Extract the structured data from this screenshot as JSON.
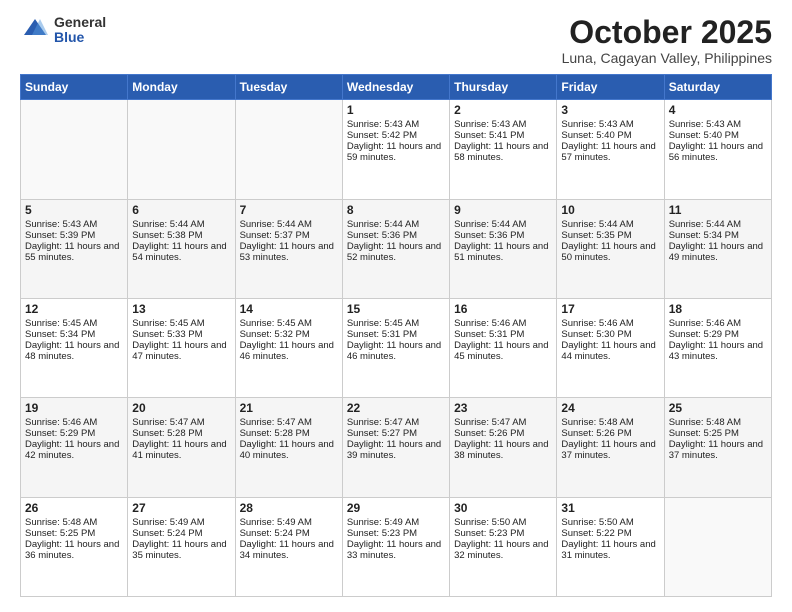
{
  "header": {
    "logo_general": "General",
    "logo_blue": "Blue",
    "month_title": "October 2025",
    "subtitle": "Luna, Cagayan Valley, Philippines"
  },
  "days_of_week": [
    "Sunday",
    "Monday",
    "Tuesday",
    "Wednesday",
    "Thursday",
    "Friday",
    "Saturday"
  ],
  "weeks": [
    [
      {
        "day": "",
        "sunrise": "",
        "sunset": "",
        "daylight": ""
      },
      {
        "day": "",
        "sunrise": "",
        "sunset": "",
        "daylight": ""
      },
      {
        "day": "",
        "sunrise": "",
        "sunset": "",
        "daylight": ""
      },
      {
        "day": "1",
        "sunrise": "Sunrise: 5:43 AM",
        "sunset": "Sunset: 5:42 PM",
        "daylight": "Daylight: 11 hours and 59 minutes."
      },
      {
        "day": "2",
        "sunrise": "Sunrise: 5:43 AM",
        "sunset": "Sunset: 5:41 PM",
        "daylight": "Daylight: 11 hours and 58 minutes."
      },
      {
        "day": "3",
        "sunrise": "Sunrise: 5:43 AM",
        "sunset": "Sunset: 5:40 PM",
        "daylight": "Daylight: 11 hours and 57 minutes."
      },
      {
        "day": "4",
        "sunrise": "Sunrise: 5:43 AM",
        "sunset": "Sunset: 5:40 PM",
        "daylight": "Daylight: 11 hours and 56 minutes."
      }
    ],
    [
      {
        "day": "5",
        "sunrise": "Sunrise: 5:43 AM",
        "sunset": "Sunset: 5:39 PM",
        "daylight": "Daylight: 11 hours and 55 minutes."
      },
      {
        "day": "6",
        "sunrise": "Sunrise: 5:44 AM",
        "sunset": "Sunset: 5:38 PM",
        "daylight": "Daylight: 11 hours and 54 minutes."
      },
      {
        "day": "7",
        "sunrise": "Sunrise: 5:44 AM",
        "sunset": "Sunset: 5:37 PM",
        "daylight": "Daylight: 11 hours and 53 minutes."
      },
      {
        "day": "8",
        "sunrise": "Sunrise: 5:44 AM",
        "sunset": "Sunset: 5:36 PM",
        "daylight": "Daylight: 11 hours and 52 minutes."
      },
      {
        "day": "9",
        "sunrise": "Sunrise: 5:44 AM",
        "sunset": "Sunset: 5:36 PM",
        "daylight": "Daylight: 11 hours and 51 minutes."
      },
      {
        "day": "10",
        "sunrise": "Sunrise: 5:44 AM",
        "sunset": "Sunset: 5:35 PM",
        "daylight": "Daylight: 11 hours and 50 minutes."
      },
      {
        "day": "11",
        "sunrise": "Sunrise: 5:44 AM",
        "sunset": "Sunset: 5:34 PM",
        "daylight": "Daylight: 11 hours and 49 minutes."
      }
    ],
    [
      {
        "day": "12",
        "sunrise": "Sunrise: 5:45 AM",
        "sunset": "Sunset: 5:34 PM",
        "daylight": "Daylight: 11 hours and 48 minutes."
      },
      {
        "day": "13",
        "sunrise": "Sunrise: 5:45 AM",
        "sunset": "Sunset: 5:33 PM",
        "daylight": "Daylight: 11 hours and 47 minutes."
      },
      {
        "day": "14",
        "sunrise": "Sunrise: 5:45 AM",
        "sunset": "Sunset: 5:32 PM",
        "daylight": "Daylight: 11 hours and 46 minutes."
      },
      {
        "day": "15",
        "sunrise": "Sunrise: 5:45 AM",
        "sunset": "Sunset: 5:31 PM",
        "daylight": "Daylight: 11 hours and 46 minutes."
      },
      {
        "day": "16",
        "sunrise": "Sunrise: 5:46 AM",
        "sunset": "Sunset: 5:31 PM",
        "daylight": "Daylight: 11 hours and 45 minutes."
      },
      {
        "day": "17",
        "sunrise": "Sunrise: 5:46 AM",
        "sunset": "Sunset: 5:30 PM",
        "daylight": "Daylight: 11 hours and 44 minutes."
      },
      {
        "day": "18",
        "sunrise": "Sunrise: 5:46 AM",
        "sunset": "Sunset: 5:29 PM",
        "daylight": "Daylight: 11 hours and 43 minutes."
      }
    ],
    [
      {
        "day": "19",
        "sunrise": "Sunrise: 5:46 AM",
        "sunset": "Sunset: 5:29 PM",
        "daylight": "Daylight: 11 hours and 42 minutes."
      },
      {
        "day": "20",
        "sunrise": "Sunrise: 5:47 AM",
        "sunset": "Sunset: 5:28 PM",
        "daylight": "Daylight: 11 hours and 41 minutes."
      },
      {
        "day": "21",
        "sunrise": "Sunrise: 5:47 AM",
        "sunset": "Sunset: 5:28 PM",
        "daylight": "Daylight: 11 hours and 40 minutes."
      },
      {
        "day": "22",
        "sunrise": "Sunrise: 5:47 AM",
        "sunset": "Sunset: 5:27 PM",
        "daylight": "Daylight: 11 hours and 39 minutes."
      },
      {
        "day": "23",
        "sunrise": "Sunrise: 5:47 AM",
        "sunset": "Sunset: 5:26 PM",
        "daylight": "Daylight: 11 hours and 38 minutes."
      },
      {
        "day": "24",
        "sunrise": "Sunrise: 5:48 AM",
        "sunset": "Sunset: 5:26 PM",
        "daylight": "Daylight: 11 hours and 37 minutes."
      },
      {
        "day": "25",
        "sunrise": "Sunrise: 5:48 AM",
        "sunset": "Sunset: 5:25 PM",
        "daylight": "Daylight: 11 hours and 37 minutes."
      }
    ],
    [
      {
        "day": "26",
        "sunrise": "Sunrise: 5:48 AM",
        "sunset": "Sunset: 5:25 PM",
        "daylight": "Daylight: 11 hours and 36 minutes."
      },
      {
        "day": "27",
        "sunrise": "Sunrise: 5:49 AM",
        "sunset": "Sunset: 5:24 PM",
        "daylight": "Daylight: 11 hours and 35 minutes."
      },
      {
        "day": "28",
        "sunrise": "Sunrise: 5:49 AM",
        "sunset": "Sunset: 5:24 PM",
        "daylight": "Daylight: 11 hours and 34 minutes."
      },
      {
        "day": "29",
        "sunrise": "Sunrise: 5:49 AM",
        "sunset": "Sunset: 5:23 PM",
        "daylight": "Daylight: 11 hours and 33 minutes."
      },
      {
        "day": "30",
        "sunrise": "Sunrise: 5:50 AM",
        "sunset": "Sunset: 5:23 PM",
        "daylight": "Daylight: 11 hours and 32 minutes."
      },
      {
        "day": "31",
        "sunrise": "Sunrise: 5:50 AM",
        "sunset": "Sunset: 5:22 PM",
        "daylight": "Daylight: 11 hours and 31 minutes."
      },
      {
        "day": "",
        "sunrise": "",
        "sunset": "",
        "daylight": ""
      }
    ]
  ]
}
